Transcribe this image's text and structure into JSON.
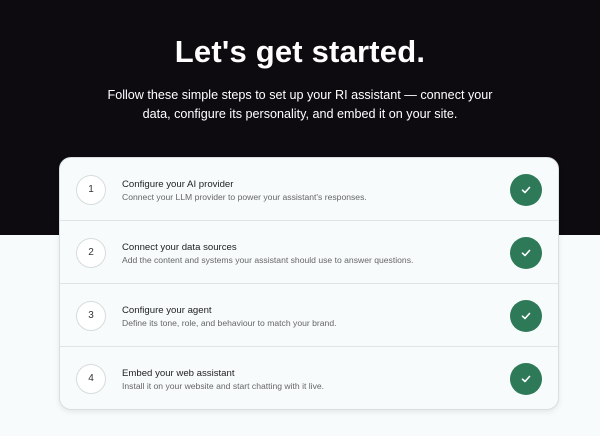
{
  "header": {
    "title": "Let's get started.",
    "subtitle": "Follow these simple steps to set up your RI assistant — connect your data, configure its personality, and embed it on your site."
  },
  "colors": {
    "hero_bg": "#0e0b10",
    "check_bg": "#2e7a58"
  },
  "steps": [
    {
      "number": "1",
      "title": "Configure your AI provider",
      "description": "Connect your LLM provider to power your assistant's responses.",
      "completed": true
    },
    {
      "number": "2",
      "title": "Connect your data sources",
      "description": "Add the content and systems your assistant should use to answer questions.",
      "completed": true
    },
    {
      "number": "3",
      "title": "Configure your agent",
      "description": "Define its tone, role, and behaviour to match your brand.",
      "completed": true
    },
    {
      "number": "4",
      "title": "Embed your web assistant",
      "description": "Install it on your website and start chatting with it live.",
      "completed": true
    }
  ]
}
